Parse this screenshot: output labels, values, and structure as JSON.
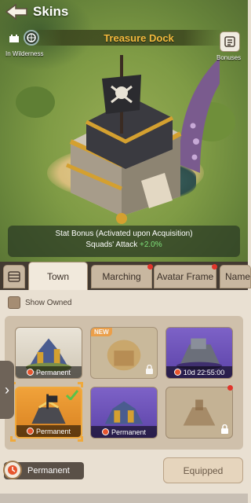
{
  "header": {
    "title": "Skins",
    "back_icon": "back-arrow-icon"
  },
  "scene": {
    "building_name": "Treasure Dock",
    "wilderness_label": "In Wilderness",
    "bonuses_label": "Bonuses",
    "stat_title": "Stat Bonus (Activated upon Acquisition)",
    "stat_name": "Squads' Attack",
    "stat_value": "+2.0%"
  },
  "tabs": [
    {
      "label": "Town",
      "active": true
    },
    {
      "label": "Marching",
      "badge": true
    },
    {
      "label": "Avatar Frame",
      "badge": true
    },
    {
      "label": "Name"
    }
  ],
  "filter": {
    "show_owned_label": "Show Owned"
  },
  "cards": [
    {
      "label": "Permanent"
    },
    {
      "label": "",
      "badge": "NEW",
      "locked": true
    },
    {
      "label": "10d 22:55:00"
    },
    {
      "label": "Permanent",
      "selected": true,
      "equipped": true
    },
    {
      "label": "Permanent"
    },
    {
      "label": "",
      "locked": true
    }
  ],
  "footer": {
    "duration": "Permanent",
    "action": "Equipped"
  },
  "colors": {
    "accent": "#f0a93b",
    "stat_green": "#7fe07a",
    "badge_red": "#e0352b"
  }
}
